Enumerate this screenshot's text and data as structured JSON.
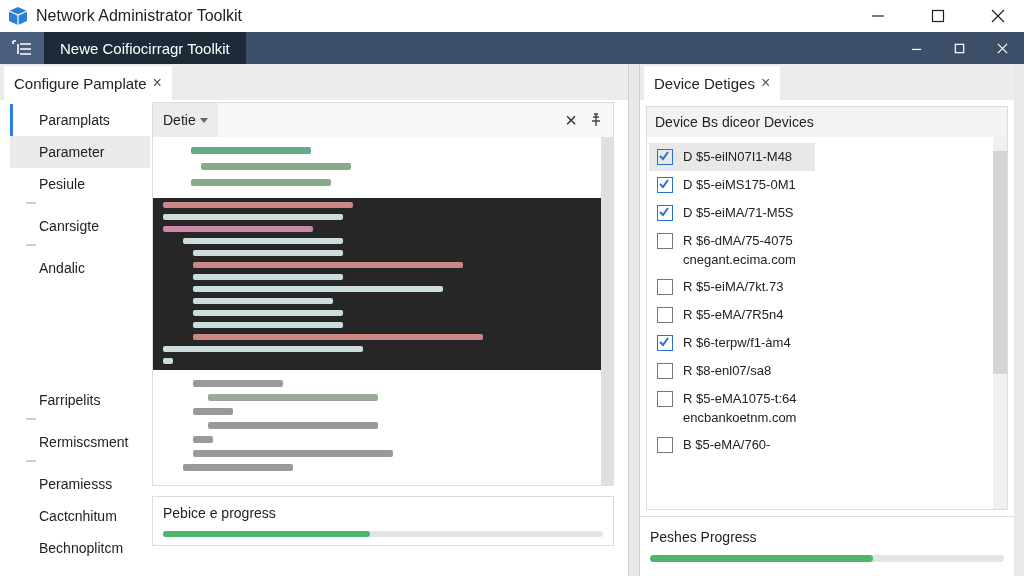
{
  "window": {
    "title": "Network Administrator Toolkit"
  },
  "nav_bar": {
    "tab": "Newe Coifiocirragr Toolkit"
  },
  "left_panel": {
    "tab": {
      "label": "Configure Pamplate",
      "close": "×"
    },
    "sidebar": {
      "items": [
        {
          "label": "Paramplats",
          "selected": true,
          "highlighted": false,
          "divider": false
        },
        {
          "label": "Parameter",
          "selected": false,
          "highlighted": true,
          "divider": false
        },
        {
          "label": "Pesiule",
          "selected": false,
          "highlighted": false,
          "divider": true
        },
        {
          "label": "Canrsigte",
          "selected": false,
          "highlighted": false,
          "divider": true
        },
        {
          "label": "Andalic",
          "selected": false,
          "highlighted": false,
          "divider": false
        },
        {
          "label": "Farripelits",
          "selected": false,
          "highlighted": false,
          "divider": true
        },
        {
          "label": "Rermiscsment",
          "selected": false,
          "highlighted": false,
          "divider": true
        },
        {
          "label": "Peramiesss",
          "selected": false,
          "highlighted": false,
          "divider": false
        },
        {
          "label": "Cactcnhitum",
          "selected": false,
          "highlighted": false,
          "divider": false
        },
        {
          "label": "Bechnoplitcm",
          "selected": false,
          "highlighted": false,
          "divider": false
        }
      ]
    },
    "editor": {
      "dropdown": "Detie",
      "close": "×"
    },
    "progress": {
      "label": "Pebice e progress",
      "level": 0.47
    }
  },
  "right_panel": {
    "tab": {
      "label": "Device Detiges",
      "close": "×"
    },
    "list_header": "Device Bs diceor Devices",
    "devices": [
      {
        "name": "D $5-eilN07I1-M48",
        "checked": true,
        "selected": true
      },
      {
        "name": "D $5-eiMS175-0M1",
        "checked": true,
        "selected": false
      },
      {
        "name": "D $5-eiMA/71-M5S",
        "checked": true,
        "selected": false
      },
      {
        "name": "R $6-dMA/75-4075",
        "host": "cnegant.ecima.com",
        "checked": false,
        "selected": false
      },
      {
        "name": "R $5-eiMA/7kt.73",
        "checked": false,
        "selected": false
      },
      {
        "name": "R $5-eMA/7R5n4",
        "checked": false,
        "selected": false
      },
      {
        "name": "R $6-terpw/f1-àm4",
        "checked": true,
        "selected": false
      },
      {
        "name": "R $8-enl07/sa8",
        "checked": false,
        "selected": false
      },
      {
        "name": "R $5-eMA1075-t:64",
        "host": "encbankoetnm.com",
        "checked": false,
        "selected": false
      },
      {
        "name": "B $5-eMA/760-",
        "checked": false,
        "selected": false
      }
    ],
    "progress": {
      "label": "Peshes Progress",
      "level": 0.63
    }
  }
}
